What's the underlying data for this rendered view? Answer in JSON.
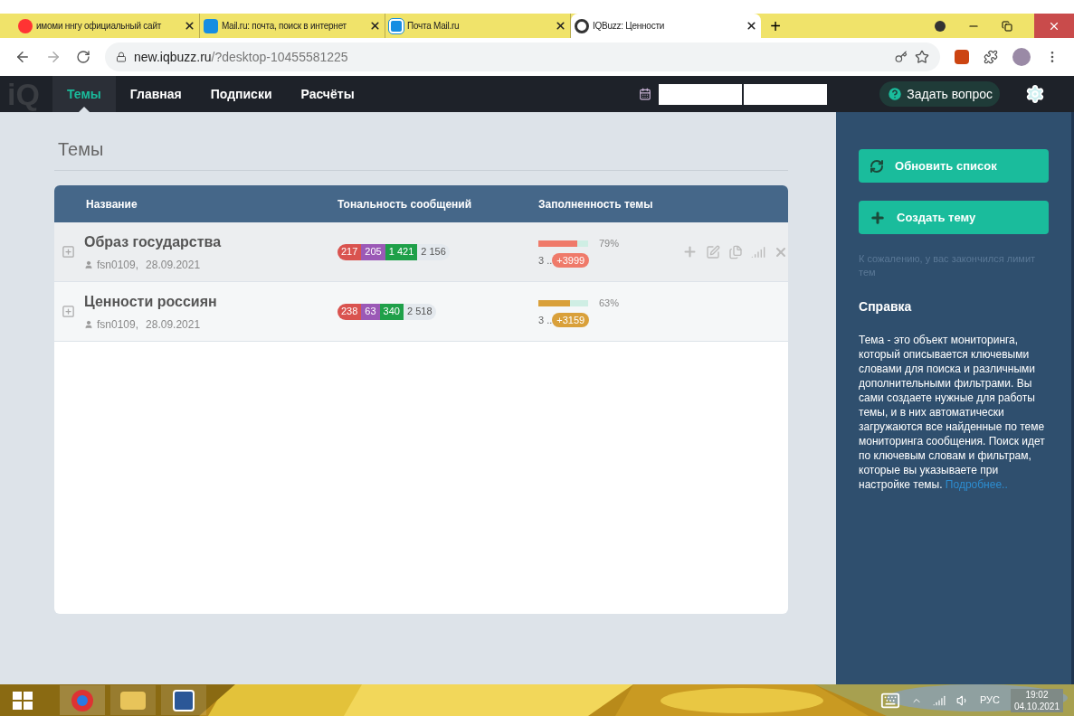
{
  "browser": {
    "tabs": [
      {
        "title": "имоми ннгу официальный сайт",
        "selected": false
      },
      {
        "title": "Mail.ru: почта, поиск в интернет",
        "selected": false
      },
      {
        "title": "Почта Mail.ru",
        "selected": false
      },
      {
        "title": "IQBuzz: Ценности",
        "selected": true
      }
    ],
    "new_tab": "+",
    "url_host": "new.iqbuzz.ru",
    "url_path": "/?desktop-10455581225"
  },
  "nav": {
    "logo": "iQ",
    "items": [
      {
        "label": "Темы",
        "selected": true
      },
      {
        "label": "Главная",
        "selected": false
      },
      {
        "label": "Подписки",
        "selected": false
      },
      {
        "label": "Расчёты",
        "selected": false
      }
    ],
    "ask_button": "Задать вопрос"
  },
  "page_title": "Темы",
  "table": {
    "columns": [
      "Название",
      "Тональность сообщений",
      "Заполненность темы"
    ],
    "rows": [
      {
        "name": "Образ государства",
        "author": "fsn0109,",
        "date": "28.09.2021",
        "tonality": [
          {
            "kind": "negative",
            "value": "217"
          },
          {
            "kind": "neutral",
            "value": "205"
          },
          {
            "kind": "positive",
            "value": "1 421"
          },
          {
            "kind": "total",
            "value": "2 156"
          }
        ],
        "level": 0.79,
        "color": "#ef7a6a",
        "percent": "79%",
        "count": "3 ..",
        "badge": "+3999",
        "hovered": true
      },
      {
        "name": "Ценности россиян",
        "author": "fsn0109,",
        "date": "28.09.2021",
        "tonality": [
          {
            "kind": "negative",
            "value": "238"
          },
          {
            "kind": "neutral",
            "value": "63"
          },
          {
            "kind": "positive",
            "value": "340"
          },
          {
            "kind": "total",
            "value": "2 518"
          }
        ],
        "level": 0.63,
        "color": "#d9a03a",
        "percent": "63%",
        "count": "3 ..",
        "badge": "+3159",
        "hovered": false
      }
    ]
  },
  "sidebar": {
    "buttons": [
      {
        "kind": "refresh",
        "label": "Обновить список"
      },
      {
        "kind": "create",
        "label": "Создать тему"
      }
    ],
    "limit_note": "К сожалению, у вас закончился лимит тем",
    "help_title": "Справка",
    "help_text": "Тема - это объект мониторинга, который описывается ключевыми словами для поиска и различными дополнительными фильтрами. Вы сами создаете нужные для работы темы, и в них автоматически загружаются все найденные по теме мониторинга сообщения. Поиск идет по ключевым словам и фильтрам, которые вы указываете при настройке темы.",
    "help_link": "Подробнее.."
  },
  "taskbar": {
    "language": "РУС",
    "time": "19:02",
    "date": "04.10.2021"
  }
}
